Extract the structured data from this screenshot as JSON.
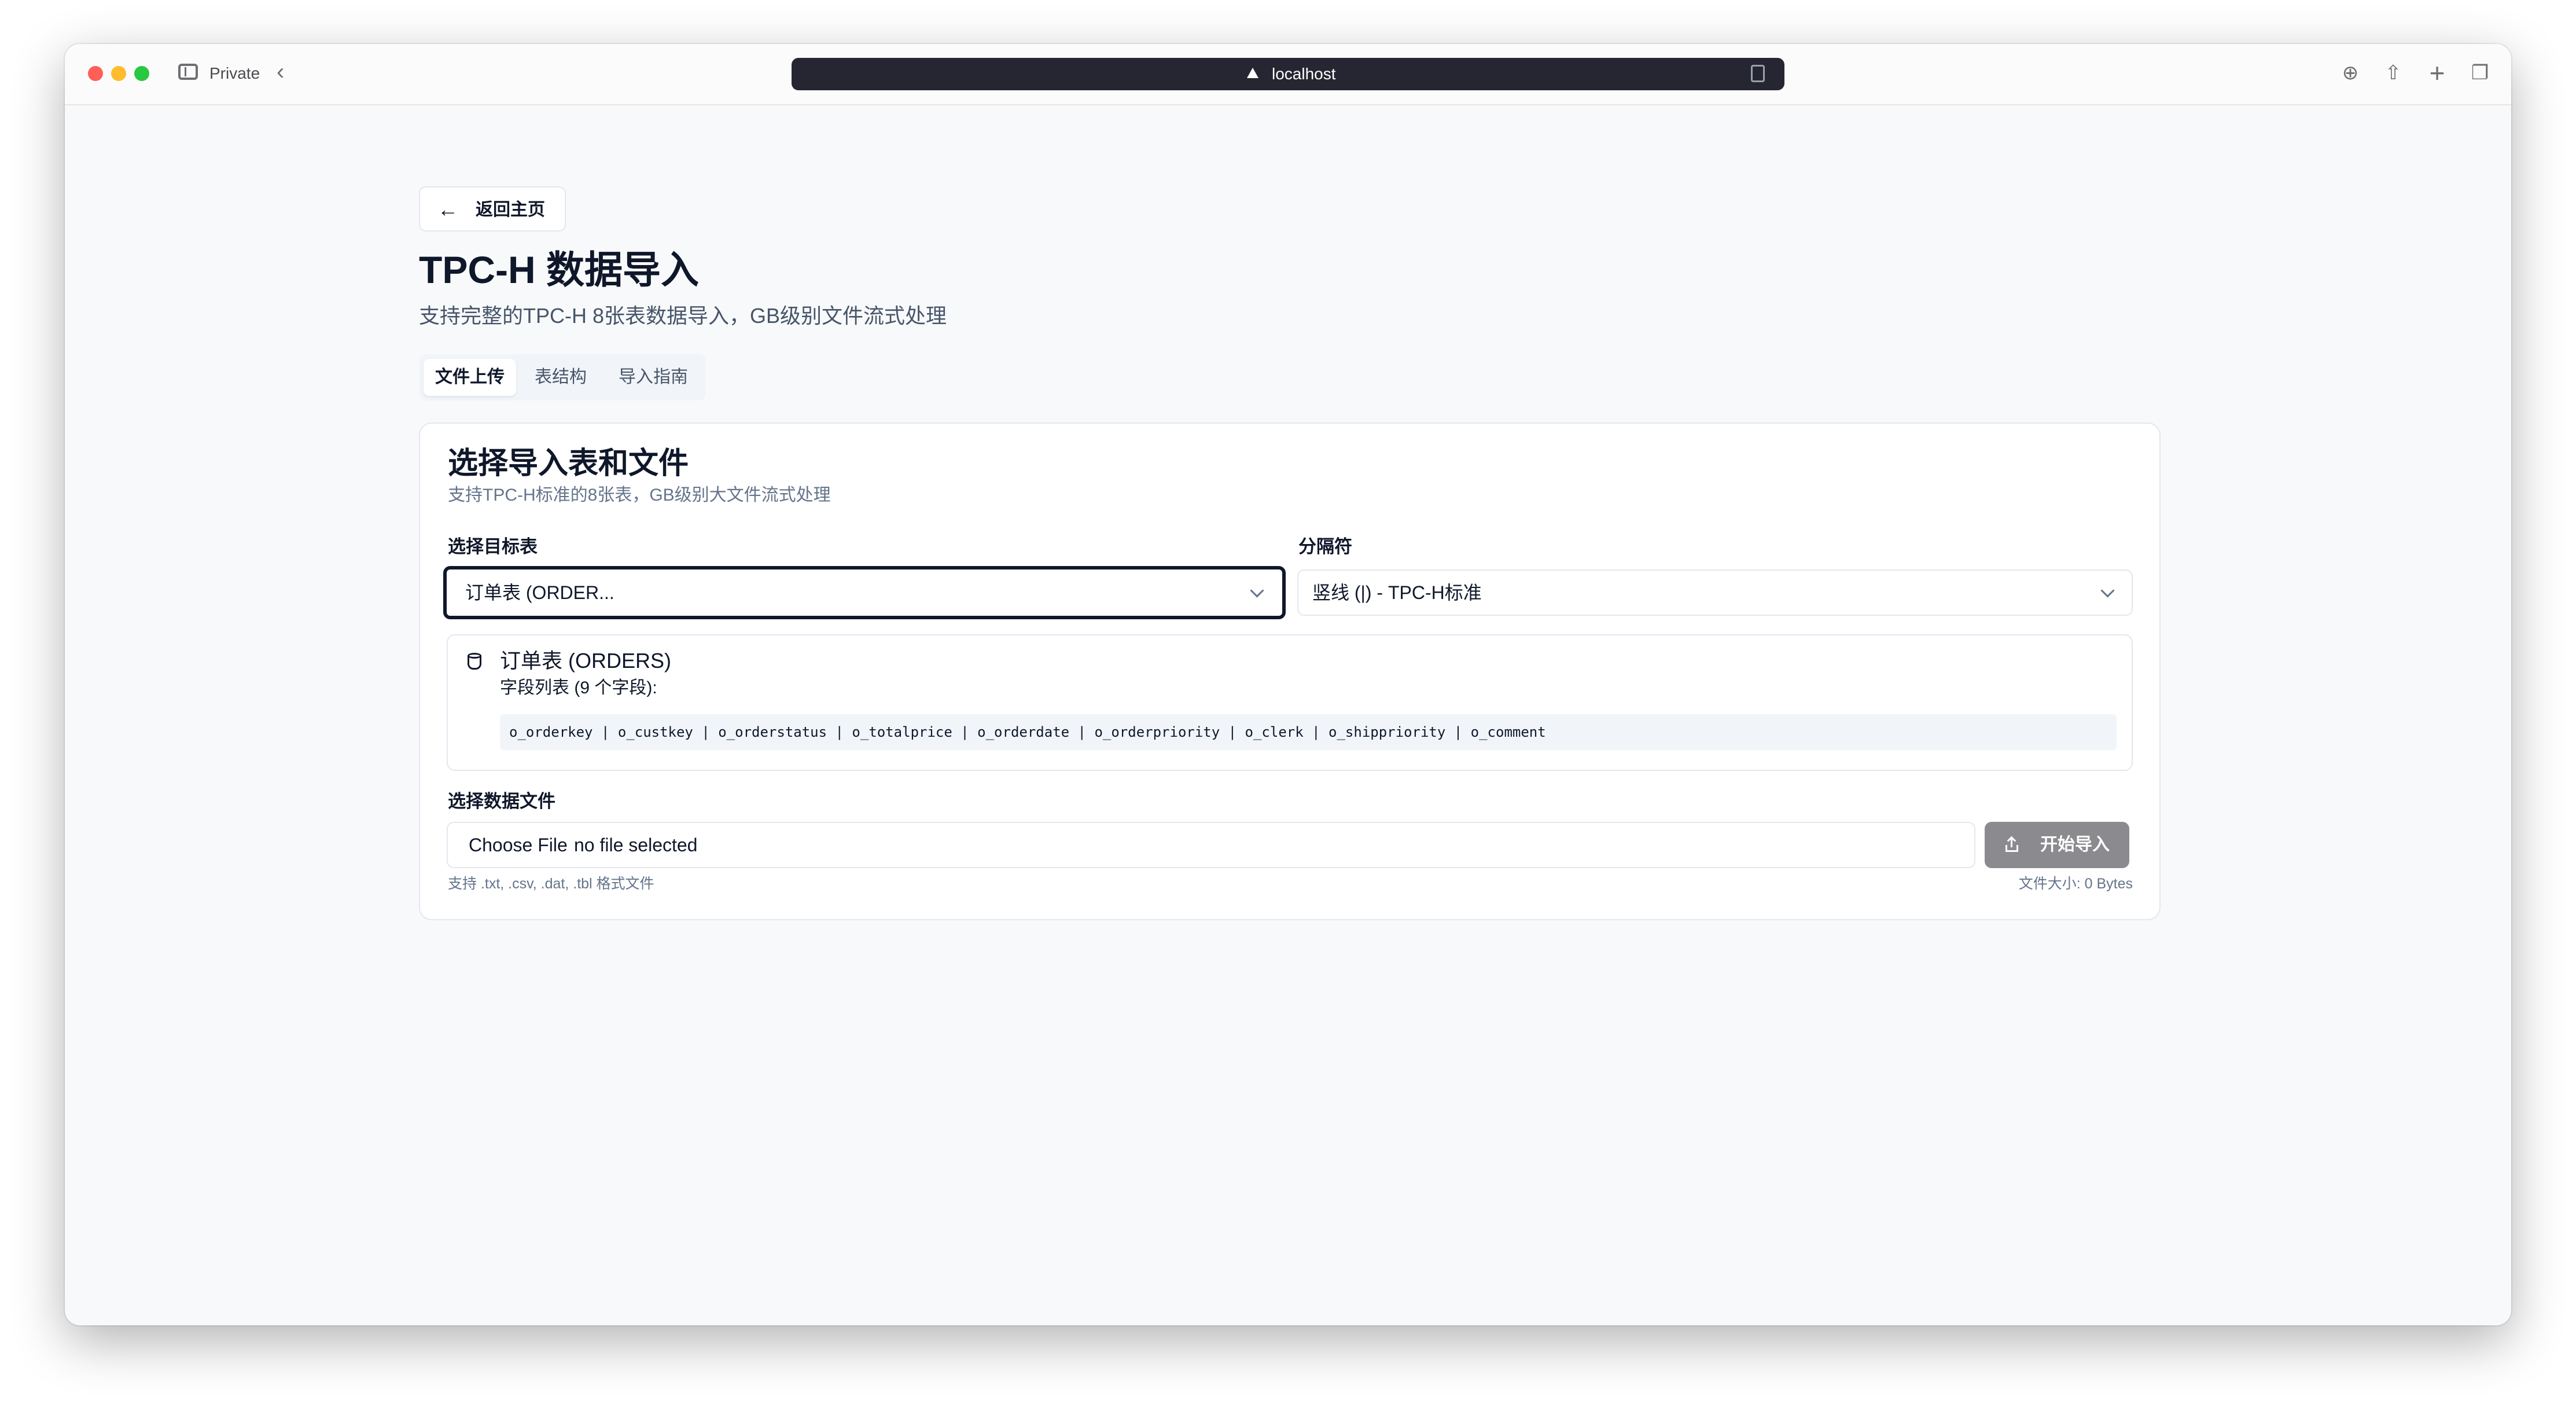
{
  "browser": {
    "mode_label": "Private",
    "url": "localhost",
    "traffic_lights": {
      "close": "#ff5f57",
      "minimize": "#febc2e",
      "zoom": "#28c840"
    }
  },
  "nav": {
    "back_label": "返回主页"
  },
  "page": {
    "title": "TPC-H 数据导入",
    "subtitle": "支持完整的TPC-H 8张表数据导入，GB级别文件流式处理"
  },
  "tabs": [
    {
      "label": "文件上传",
      "active": true
    },
    {
      "label": "表结构",
      "active": false
    },
    {
      "label": "导入指南",
      "active": false
    }
  ],
  "card": {
    "title": "选择导入表和文件",
    "description": "支持TPC-H标准的8张表，GB级别大文件流式处理",
    "target_table": {
      "label": "选择目标表",
      "value": "订单表 (ORDER..."
    },
    "delimiter": {
      "label": "分隔符",
      "value": "竖线 (|) - TPC-H标准"
    },
    "table_info": {
      "name": "订单表 (ORDERS)",
      "fields_title": "字段列表 (9 个字段):",
      "fields": "o_orderkey | o_custkey | o_orderstatus | o_totalprice | o_orderdate | o_orderpriority | o_clerk | o_shippriority | o_comment"
    },
    "file": {
      "label": "选择数据文件",
      "choose_label": "Choose File",
      "status": "no file selected",
      "hint": "支持 .txt, .csv, .dat, .tbl 格式文件",
      "size": "文件大小: 0 Bytes"
    },
    "import_button": {
      "label": "开始导入",
      "color": "#8b8b8f"
    }
  }
}
